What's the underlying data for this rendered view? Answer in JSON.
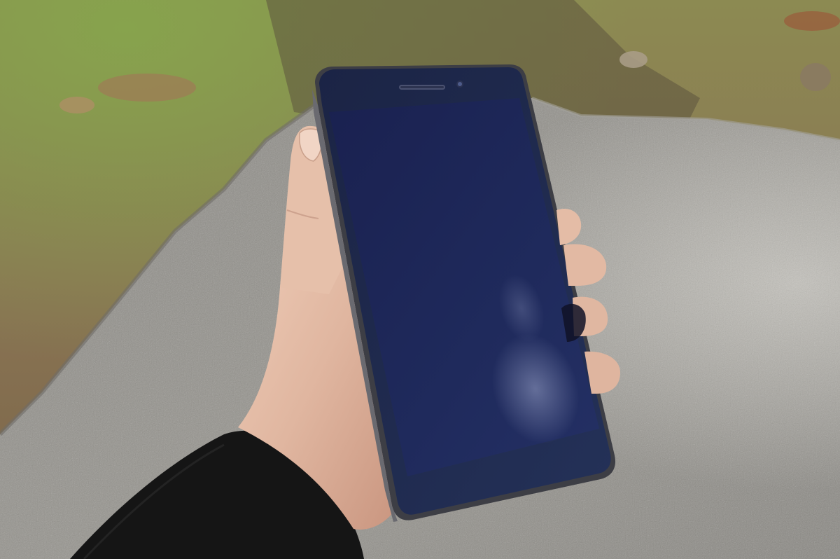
{
  "scene": {
    "colors": {
      "ground": "#8c7b5a",
      "grass": "#7d9a4a",
      "rock": "#8f8d88",
      "rock_shadow": "#6e6c68",
      "phone_frame": "#3c3d44",
      "phone_glass": "#1d2a4e",
      "screen": "#1c2456",
      "skin": "#e0b9a4",
      "sleeve": "#161616"
    },
    "icons": {
      "earpiece": "earpiece-grille-icon",
      "camera": "front-camera-icon"
    }
  }
}
